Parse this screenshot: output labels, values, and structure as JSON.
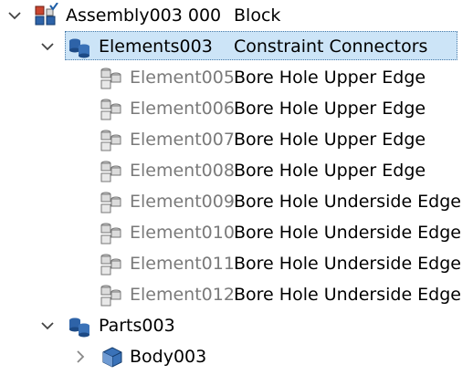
{
  "tree": {
    "assembly": {
      "label": "Assembly003 000",
      "desc": "Block",
      "icon": "assembly-icon"
    },
    "elements": {
      "label": "Elements003",
      "desc": "Constraint Connectors",
      "icon": "elements-group-icon"
    },
    "element_items": [
      {
        "label": "Element005",
        "desc": "Bore Hole Upper Edge"
      },
      {
        "label": "Element006",
        "desc": "Bore Hole Upper Edge"
      },
      {
        "label": "Element007",
        "desc": "Bore Hole Upper Edge"
      },
      {
        "label": "Element008",
        "desc": "Bore Hole Upper Edge"
      },
      {
        "label": "Element009",
        "desc": "Bore Hole Underside Edge"
      },
      {
        "label": "Element010",
        "desc": "Bore Hole Underside Edge"
      },
      {
        "label": "Element011",
        "desc": "Bore Hole Underside Edge"
      },
      {
        "label": "Element012",
        "desc": "Bore Hole Underside Edge"
      }
    ],
    "parts": {
      "label": "Parts003",
      "icon": "parts-group-icon"
    },
    "body": {
      "label": "Body003",
      "icon": "body-icon"
    }
  },
  "colors": {
    "selection": "#cce4f7",
    "muted_text": "#7a7a7a",
    "icon_blue": "#1f5fa8"
  }
}
